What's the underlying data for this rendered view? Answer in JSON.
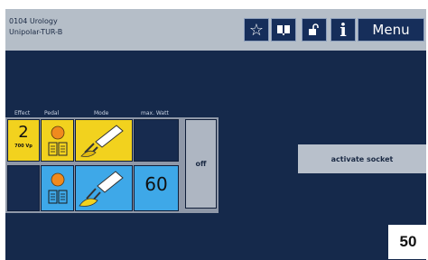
{
  "header": {
    "program_line1": "0104 Urology",
    "program_line2": "Unipolar-TUR-B",
    "menu_label": "Menu",
    "info_label": "i"
  },
  "icons": {
    "favorite": "star-icon",
    "manual": "book-icon",
    "lock": "unlock-icon",
    "info": "info-icon"
  },
  "columns": {
    "effect": "Effect",
    "pedal": "Pedal",
    "mode": "Mode",
    "max_watt": "max. Watt"
  },
  "row1": {
    "effect_value": "2",
    "effect_sub": "700 Vp"
  },
  "row2": {
    "watt_value": "60"
  },
  "status": {
    "off_label": "off"
  },
  "activate_socket_label": "activate socket",
  "page_number": "50",
  "colors": {
    "background": "#15294b",
    "header": "#b5bec8",
    "effect_yellow": "#f2d21e",
    "active_blue": "#3ea8e8",
    "pedal_orange": "#f08a1e"
  }
}
